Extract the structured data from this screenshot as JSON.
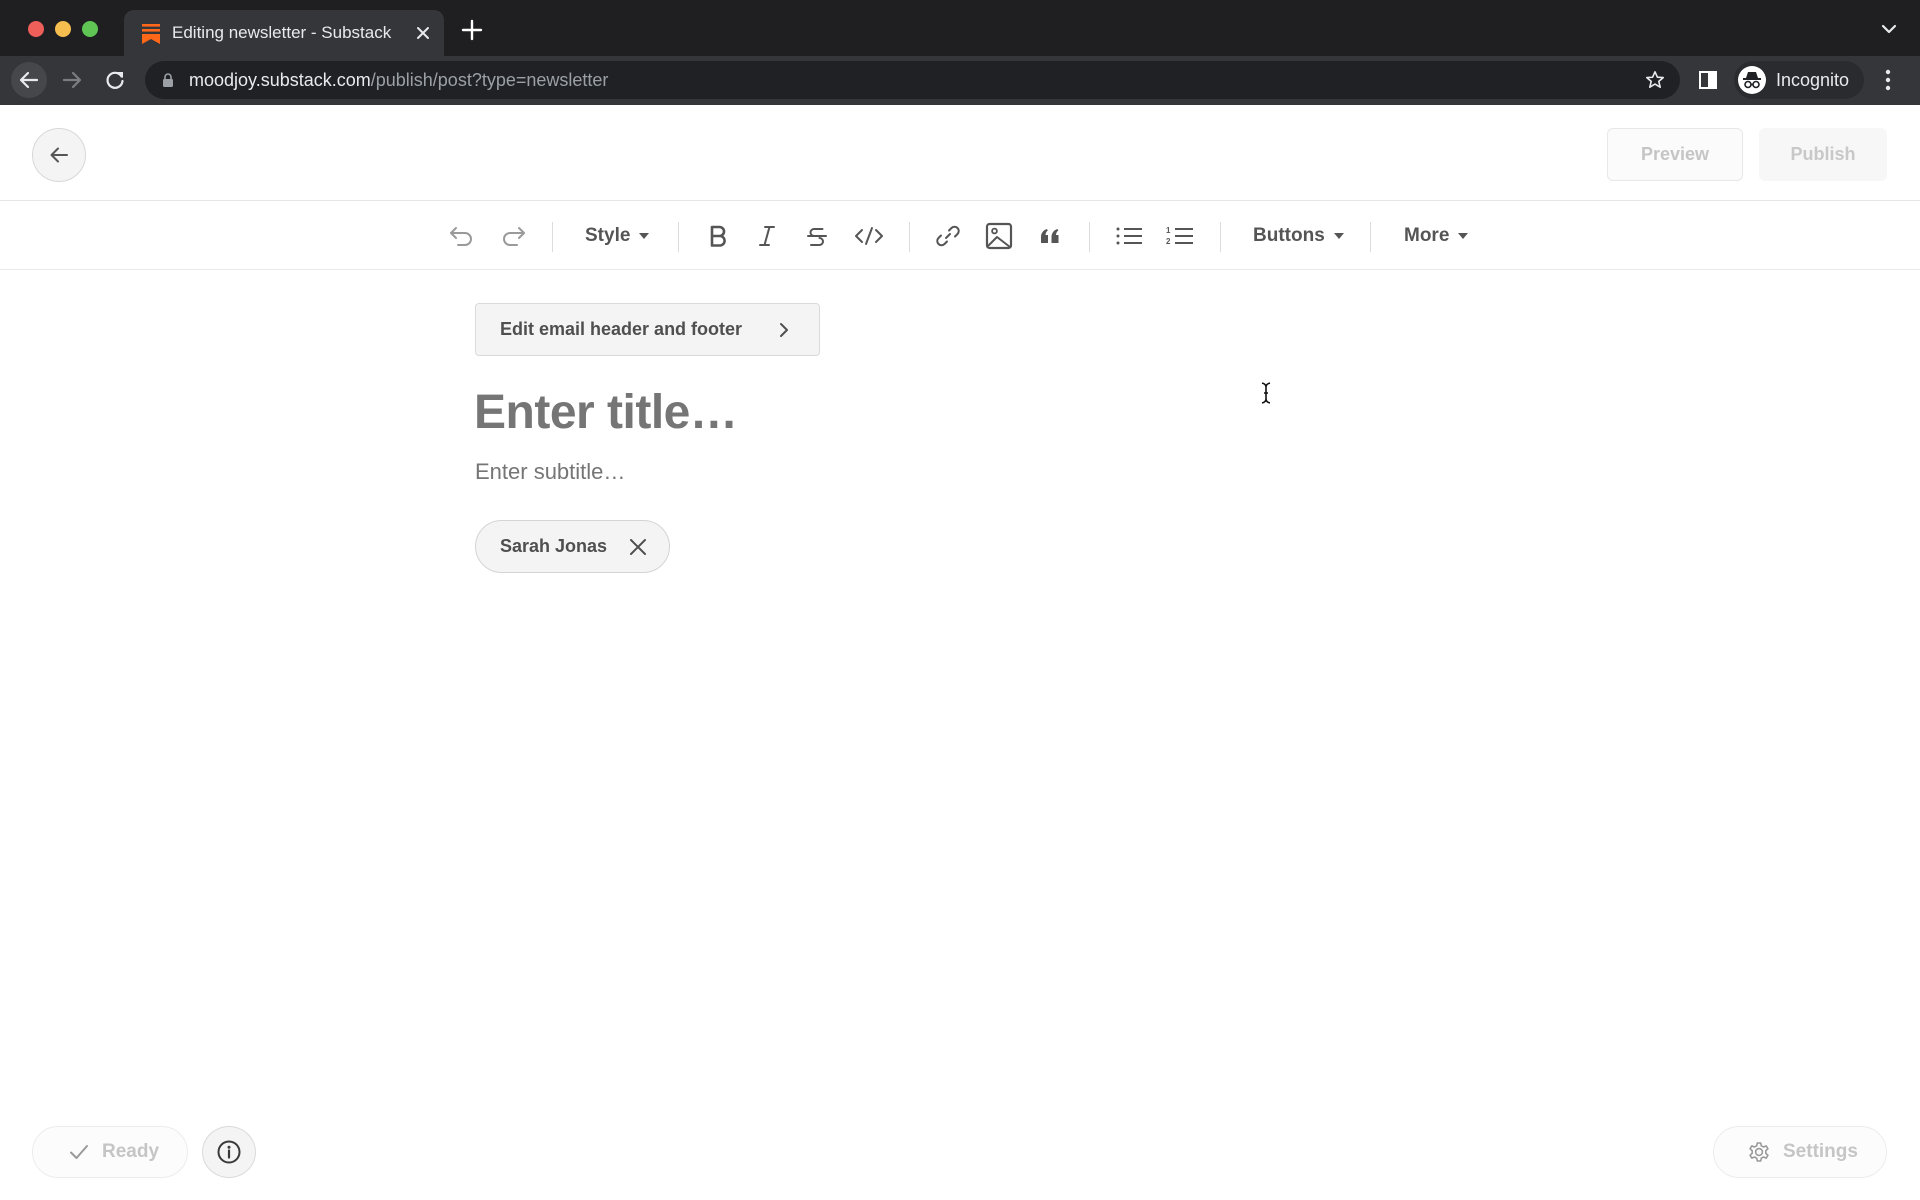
{
  "browser": {
    "tab": {
      "title": "Editing newsletter - Substack",
      "favicon": "substack-logo-icon",
      "close_icon": "close-icon"
    },
    "new_tab_icon": "plus-icon",
    "tab_search_icon": "chevron-down-icon",
    "nav": {
      "back_icon": "arrow-left-icon",
      "forward_icon": "arrow-right-icon",
      "reload_icon": "reload-icon"
    },
    "address_bar": {
      "lock_icon": "lock-icon",
      "host": "moodjoy.substack.com",
      "path": "/publish/post?type=newsletter",
      "bookmark_icon": "star-icon"
    },
    "side_panel_icon": "side-panel-icon",
    "profile": {
      "label": "Incognito",
      "icon": "incognito-icon"
    },
    "menu_icon": "kebab-menu-icon"
  },
  "header": {
    "back_icon": "arrow-left-icon",
    "preview_label": "Preview",
    "publish_label": "Publish"
  },
  "toolbar": {
    "undo_icon": "undo-icon",
    "redo_icon": "redo-icon",
    "style_label": "Style",
    "bold_icon": "bold-icon",
    "italic_icon": "italic-icon",
    "strikethrough_icon": "strikethrough-icon",
    "code_icon": "code-icon",
    "link_icon": "link-icon",
    "image_icon": "image-icon",
    "quote_icon": "quote-icon",
    "bullet_list_icon": "bullet-list-icon",
    "numbered_list_icon": "numbered-list-icon",
    "buttons_label": "Buttons",
    "more_label": "More"
  },
  "editor": {
    "edit_header_footer_label": "Edit email header and footer",
    "title_placeholder": "Enter title…",
    "title_value": "",
    "subtitle_placeholder": "Enter subtitle…",
    "subtitle_value": "",
    "author": "Sarah Jonas"
  },
  "footer": {
    "status_label": "Ready",
    "settings_label": "Settings"
  },
  "colors": {
    "substack_orange": "#ff6719",
    "chrome_dark": "#202124",
    "muted_text": "#c5c5c5"
  }
}
